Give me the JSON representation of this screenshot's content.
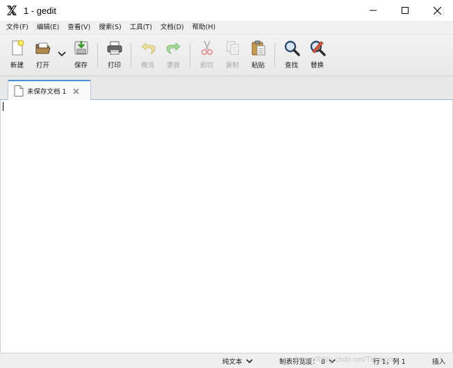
{
  "window": {
    "title": "1 - gedit"
  },
  "menu": {
    "items": [
      "文件(F)",
      "编辑(E)",
      "查看(V)",
      "搜索(S)",
      "工具(T)",
      "文档(D)",
      "帮助(H)"
    ]
  },
  "toolbar": {
    "new_label": "新建",
    "open_label": "打开",
    "save_label": "保存",
    "print_label": "打印",
    "undo_label": "撤消",
    "redo_label": "重做",
    "cut_label": "剪切",
    "copy_label": "复制",
    "paste_label": "粘贴",
    "find_label": "查找",
    "replace_label": "替换"
  },
  "tabs": [
    {
      "label": "未保存文档 1",
      "icon": "document-icon"
    }
  ],
  "statusbar": {
    "language": "纯文本",
    "tab_width": "制表符宽度：  8",
    "position": "行 1，列 1",
    "mode": "插入",
    "watermark": "https://blog.csdn.net/Tinyeoner"
  },
  "colors": {
    "tab_accent": "#4a90d9",
    "toolbar_bg": "#ececec",
    "menubar_bg": "#f0f0f0"
  }
}
